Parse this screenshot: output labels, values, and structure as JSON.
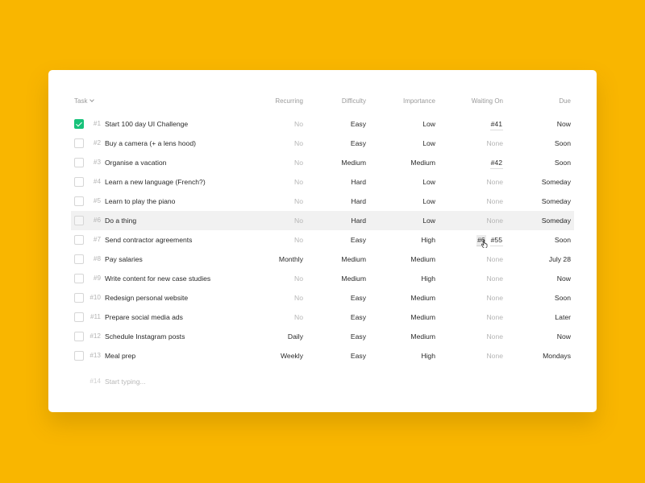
{
  "colors": {
    "background": "#F9B600",
    "checked": "#17C27A",
    "muted": "#B5B5B5"
  },
  "columns": {
    "task": "Task",
    "recurring": "Recurring",
    "difficulty": "Difficulty",
    "importance": "Importance",
    "waiting_on": "Waiting On",
    "due": "Due"
  },
  "rows": [
    {
      "num": "#1",
      "task": "Start 100 day UI Challenge",
      "recurring": "No",
      "difficulty": "Easy",
      "importance": "Low",
      "waiting_on": [
        "#41"
      ],
      "due": "Now",
      "checked": true
    },
    {
      "num": "#2",
      "task": "Buy a camera (+ a lens hood)",
      "recurring": "No",
      "difficulty": "Easy",
      "importance": "Low",
      "waiting_on": [],
      "due": "Soon",
      "checked": false
    },
    {
      "num": "#3",
      "task": "Organise a vacation",
      "recurring": "No",
      "difficulty": "Medium",
      "importance": "Medium",
      "waiting_on": [
        "#42"
      ],
      "due": "Soon",
      "checked": false
    },
    {
      "num": "#4",
      "task": "Learn a new language (French?)",
      "recurring": "No",
      "difficulty": "Hard",
      "importance": "Low",
      "waiting_on": [],
      "due": "Someday",
      "checked": false
    },
    {
      "num": "#5",
      "task": "Learn to play the piano",
      "recurring": "No",
      "difficulty": "Hard",
      "importance": "Low",
      "waiting_on": [],
      "due": "Someday",
      "checked": false
    },
    {
      "num": "#6",
      "task": "Do a thing",
      "recurring": "No",
      "difficulty": "Hard",
      "importance": "Low",
      "waiting_on": [],
      "due": "Someday",
      "checked": false,
      "highlight": true
    },
    {
      "num": "#7",
      "task": "Send contractor agreements",
      "recurring": "No",
      "difficulty": "Easy",
      "importance": "High",
      "waiting_on": [
        "#6",
        "#55"
      ],
      "due": "Soon",
      "checked": false,
      "cursor": true
    },
    {
      "num": "#8",
      "task": "Pay salaries",
      "recurring": "Monthly",
      "difficulty": "Medium",
      "importance": "Medium",
      "waiting_on": [],
      "due": "July 28",
      "checked": false
    },
    {
      "num": "#9",
      "task": "Write content for new case studies",
      "recurring": "No",
      "difficulty": "Medium",
      "importance": "High",
      "waiting_on": [],
      "due": "Now",
      "checked": false
    },
    {
      "num": "#10",
      "task": "Redesign personal website",
      "recurring": "No",
      "difficulty": "Easy",
      "importance": "Medium",
      "waiting_on": [],
      "due": "Soon",
      "checked": false
    },
    {
      "num": "#11",
      "task": "Prepare social media ads",
      "recurring": "No",
      "difficulty": "Easy",
      "importance": "Medium",
      "waiting_on": [],
      "due": "Later",
      "checked": false
    },
    {
      "num": "#12",
      "task": "Schedule Instagram posts",
      "recurring": "Daily",
      "difficulty": "Easy",
      "importance": "Medium",
      "waiting_on": [],
      "due": "Now",
      "checked": false
    },
    {
      "num": "#13",
      "task": "Meal prep",
      "recurring": "Weekly",
      "difficulty": "Easy",
      "importance": "High",
      "waiting_on": [],
      "due": "Mondays",
      "checked": false
    }
  ],
  "none_label": "None",
  "new_row": {
    "num": "#14",
    "placeholder": "Start typing..."
  }
}
